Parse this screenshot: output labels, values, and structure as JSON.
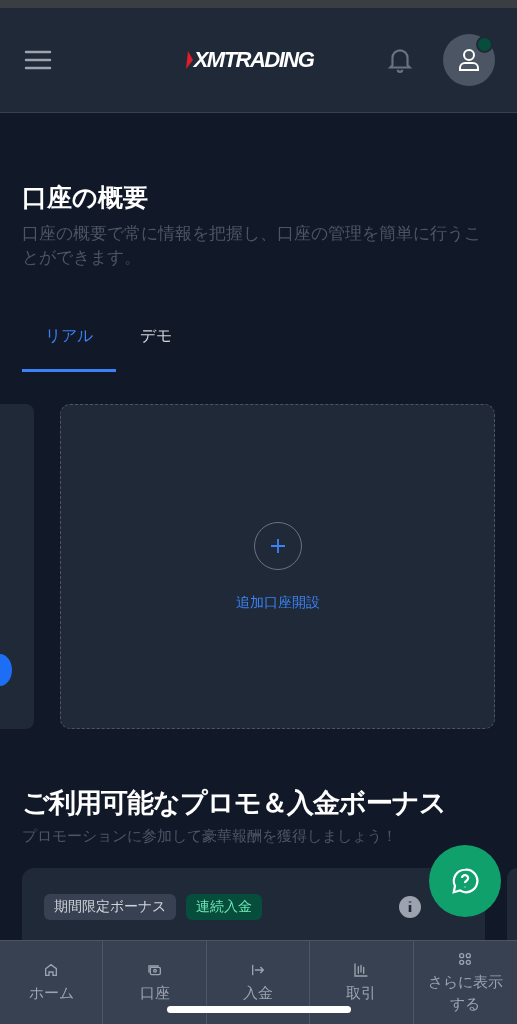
{
  "header": {
    "logo": "XMTRADING",
    "notification_dot": true
  },
  "overview": {
    "title": "口座の概要",
    "subtitle": "口座の概要で常に情報を把握し、口座の管理を簡単に行うことができます。"
  },
  "tabs": [
    {
      "label": "リアル",
      "selected": true
    },
    {
      "label": "デモ",
      "selected": false
    }
  ],
  "add_account": {
    "label": "追加口座開設"
  },
  "promo": {
    "title": "ご利用可能なプロモ＆入金ボーナス",
    "subtitle": "プロモーションに参加して豪華報酬を獲得しましょう！",
    "tags": [
      {
        "label": "期間限定ボーナス",
        "kind": "neutral"
      },
      {
        "label": "連続入金",
        "kind": "green"
      }
    ]
  },
  "bottom_nav": [
    {
      "label": "ホーム",
      "kind": "home"
    },
    {
      "label": "口座",
      "kind": "account"
    },
    {
      "label": "入金",
      "kind": "deposit"
    },
    {
      "label": "取引",
      "kind": "trade"
    },
    {
      "label": "さらに表示する",
      "kind": "more"
    }
  ]
}
